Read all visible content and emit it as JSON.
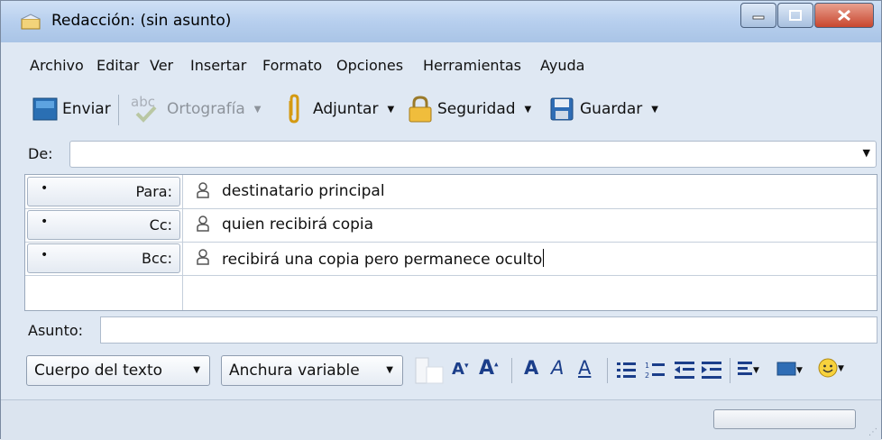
{
  "window": {
    "title": "Redacción: (sin asunto)"
  },
  "menu": [
    "Archivo",
    "Editar",
    "Ver",
    "Insertar",
    "Formato",
    "Opciones",
    "Herramientas",
    "Ayuda"
  ],
  "toolbar": {
    "send": "Enviar",
    "spelling": "Ortografía",
    "attach": "Adjuntar",
    "security": "Seguridad",
    "save": "Guardar",
    "spelling_icon_text": "abc"
  },
  "from": {
    "label": "De:",
    "value": ""
  },
  "recipients": [
    {
      "type": "Para:",
      "value": "destinatario principal"
    },
    {
      "type": "Cc:",
      "value": "quien recibirá copia"
    },
    {
      "type": "Bcc:",
      "value": "recibirá una copia pero permanece oculto"
    }
  ],
  "subject": {
    "label": "Asunto:",
    "value": ""
  },
  "format": {
    "paragraph_style": "Cuerpo del texto",
    "font": "Anchura variable",
    "smaller_text_glyph": "A",
    "larger_text_glyph": "A",
    "bold_glyph": "A",
    "italic_glyph": "A",
    "underline_glyph": "A"
  },
  "colors": {
    "accent": "#1b3e8a",
    "close": "#c8462e",
    "folder": "#f5c046"
  }
}
